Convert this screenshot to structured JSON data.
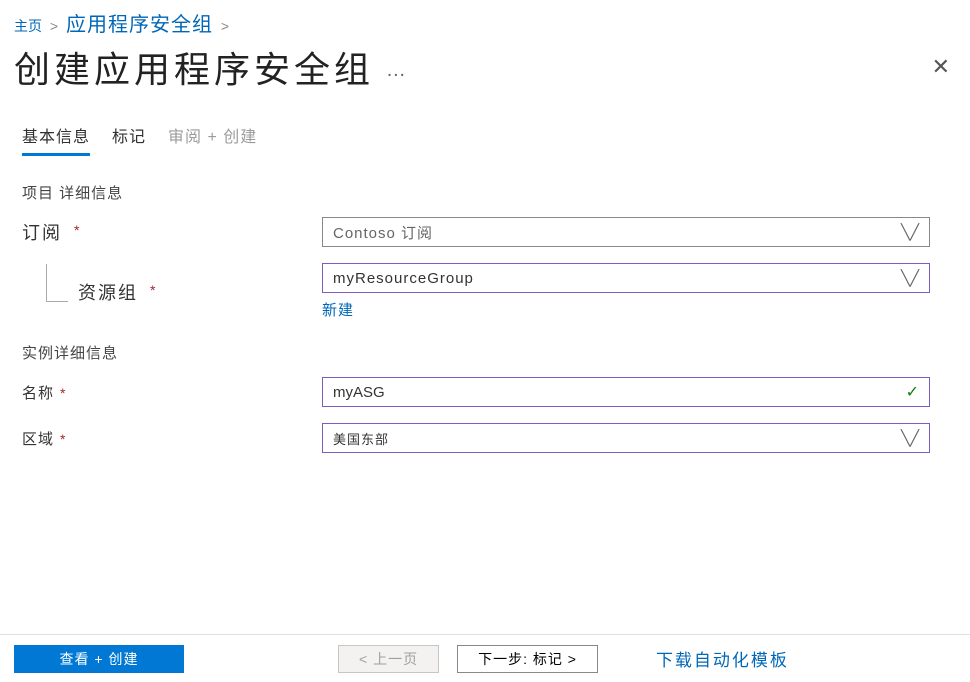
{
  "breadcrumb": {
    "home": "主页",
    "asg": "应用程序安全组"
  },
  "page": {
    "title": "创建应用程序安全组",
    "more": "…"
  },
  "tabs": {
    "basic": "基本信息",
    "tags": "标记",
    "review": "审阅 + 创建"
  },
  "sections": {
    "project": "项目 详细信息",
    "instance": "实例详细信息"
  },
  "fields": {
    "subscription": {
      "label": "订阅",
      "value": "Contoso 订阅"
    },
    "resourceGroup": {
      "label": "资源组",
      "value": "myResourceGroup",
      "newLink": "新建"
    },
    "name": {
      "label": "名称",
      "value": "myASG"
    },
    "region": {
      "label": "区域",
      "value": "美国东部"
    }
  },
  "footer": {
    "review": "查看 + 创建",
    "prev": "< 上一页",
    "next": "下一步: 标记 >",
    "download": "下载自动化模板"
  }
}
